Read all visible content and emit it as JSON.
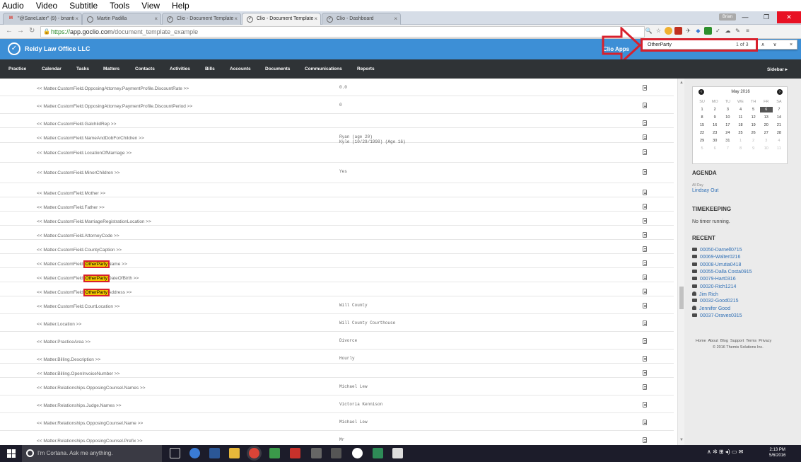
{
  "os_menu": [
    "Audio",
    "Video",
    "Subtitle",
    "Tools",
    "View",
    "Help"
  ],
  "browser": {
    "tabs": [
      {
        "label": "\"@SaneLater\" (9) - bnanti",
        "fav": "M",
        "active": false
      },
      {
        "label": "Martin Padilla",
        "fav": "",
        "active": false
      },
      {
        "label": "Clio - Document Template",
        "fav": "",
        "active": false
      },
      {
        "label": "Clio - Document Template",
        "fav": "",
        "active": true
      },
      {
        "label": "Clio - Dashboard",
        "fav": "",
        "active": false
      }
    ],
    "user_badge": "Brian",
    "url_scheme": "https://",
    "url_host": "app.goclio.com",
    "url_path": "/document_template_example"
  },
  "find_bar": {
    "query": "OtherParty",
    "count": "1 of 3"
  },
  "header": {
    "firm_name": "Reidy Law Office LLC",
    "clio_apps": "Clio Apps"
  },
  "nav": {
    "items": [
      "Practice",
      "Calendar",
      "Tasks",
      "Matters",
      "Contacts",
      "Activities",
      "Bills",
      "Accounts",
      "Documents",
      "Communications",
      "Reports"
    ],
    "sidebar_toggle": "Sidebar ▸"
  },
  "rows": [
    {
      "pre": "<< Matter.CustomField.OpposingAttorney.PaymentProfile.DiscountRate >>",
      "value": "0.0"
    },
    {
      "pre": "<< Matter.CustomField.OpposingAttorney.PaymentProfile.DiscountPeriod >>",
      "value": "0"
    },
    {
      "pre": "<< Matter.CustomField.GalchildRep >>",
      "value": ""
    },
    {
      "pre": "<< Matter.CustomField.NameAndDobForChildren >>",
      "value": "Ryan (age 20)\nKyle (10/29/1998) (Age 16)"
    },
    {
      "pre": "<< Matter.CustomField.LocationOfMarriage >>",
      "value": ""
    },
    {
      "pre": "<< Matter.CustomField.MinorChildren >>",
      "value": "Yes"
    },
    {
      "pre": "<< Matter.CustomField.Mother >>",
      "value": ""
    },
    {
      "pre": "<< Matter.CustomField.Father >>",
      "value": ""
    },
    {
      "pre": "<< Matter.CustomField.MarriageRegistrationLocation >>",
      "value": ""
    },
    {
      "pre": "<< Matter.CustomField.AttorneyCode >>",
      "value": ""
    },
    {
      "pre": "<< Matter.CustomField.CountyCaption >>",
      "value": ""
    },
    {
      "pre": "<< Matter.CustomField.",
      "hl": "OtherParty",
      "post": "Name >>",
      "value": ""
    },
    {
      "pre": "<< Matter.CustomField.",
      "hl": "OtherParty",
      "post": "DateOfBirth >>",
      "value": ""
    },
    {
      "pre": "<< Matter.CustomField.",
      "hl": "OtherParty",
      "post": "Address >>",
      "value": ""
    },
    {
      "pre": "<< Matter.CustomField.CourtLocation >>",
      "value": "Will County"
    },
    {
      "pre": "<< Matter.Location >>",
      "value": "Will County Courthouse"
    },
    {
      "pre": "<< Matter.PracticeArea >>",
      "value": "Divorce"
    },
    {
      "pre": "<< Matter.Billing.Description >>",
      "value": "Hourly"
    },
    {
      "pre": "<< Matter.Billing.OpenInvoiceNumber >>",
      "value": ""
    },
    {
      "pre": "<< Matter.Relationships.OpposingCounsel.Names >>",
      "value": "Michael Lew"
    },
    {
      "pre": "<< Matter.Relationships.Judge.Names >>",
      "value": "Victoria Kennison"
    },
    {
      "pre": "<< Matter.Relationships.OpposingCounsel.Name >>",
      "value": "Michael Lew"
    },
    {
      "pre": "<< Matter.Relationships.OpposingCounsel.Prefix >>",
      "value": "Mr"
    }
  ],
  "calendar": {
    "month": "May 2016",
    "day_headers": [
      "SU",
      "MO",
      "TU",
      "WE",
      "TH",
      "FR",
      "SA"
    ],
    "weeks": [
      [
        "1",
        "2",
        "3",
        "4",
        "5",
        "6",
        "7"
      ],
      [
        "8",
        "9",
        "10",
        "11",
        "12",
        "13",
        "14"
      ],
      [
        "15",
        "16",
        "17",
        "18",
        "19",
        "20",
        "21"
      ],
      [
        "22",
        "23",
        "24",
        "25",
        "26",
        "27",
        "28"
      ],
      [
        "29",
        "30",
        "31",
        "1",
        "2",
        "3",
        "4"
      ],
      [
        "5",
        "6",
        "7",
        "8",
        "9",
        "10",
        "11"
      ]
    ],
    "today": "6"
  },
  "sidebar": {
    "agenda_title": "AGENDA",
    "agenda_allday": "All Day",
    "agenda_item": "Lindsay Out",
    "timekeeping_title": "TIMEKEEPING",
    "timekeeping_text": "No timer running.",
    "recent_title": "RECENT",
    "recent": [
      {
        "label": "00050-Darnell0715",
        "type": "matter"
      },
      {
        "label": "00069-Walter0216",
        "type": "matter"
      },
      {
        "label": "00008-Urrutia0418",
        "type": "matter"
      },
      {
        "label": "00055-Dalla Costa0915",
        "type": "matter"
      },
      {
        "label": "00079-Hart0316",
        "type": "matter"
      },
      {
        "label": "00020-Rich1214",
        "type": "matter"
      },
      {
        "label": "Jim Rich",
        "type": "person"
      },
      {
        "label": "00032-Good0215",
        "type": "matter"
      },
      {
        "label": "Jennifer Good",
        "type": "person"
      },
      {
        "label": "00037-Draves0315",
        "type": "matter"
      }
    ],
    "footer_links": [
      "Home",
      "About",
      "Blog",
      "Support",
      "Terms",
      "Privacy"
    ],
    "copyright": "© 2016 Themis Solutions Inc."
  },
  "taskbar": {
    "cortana": "I'm Cortana. Ask me anything.",
    "time": "2:13 PM",
    "date": "5/6/2016"
  },
  "colors": {
    "clio_blue": "#3d8fd6",
    "nav_dark": "#2f3336",
    "highlight": "#f3c300",
    "annotation_red": "#d8202c"
  }
}
